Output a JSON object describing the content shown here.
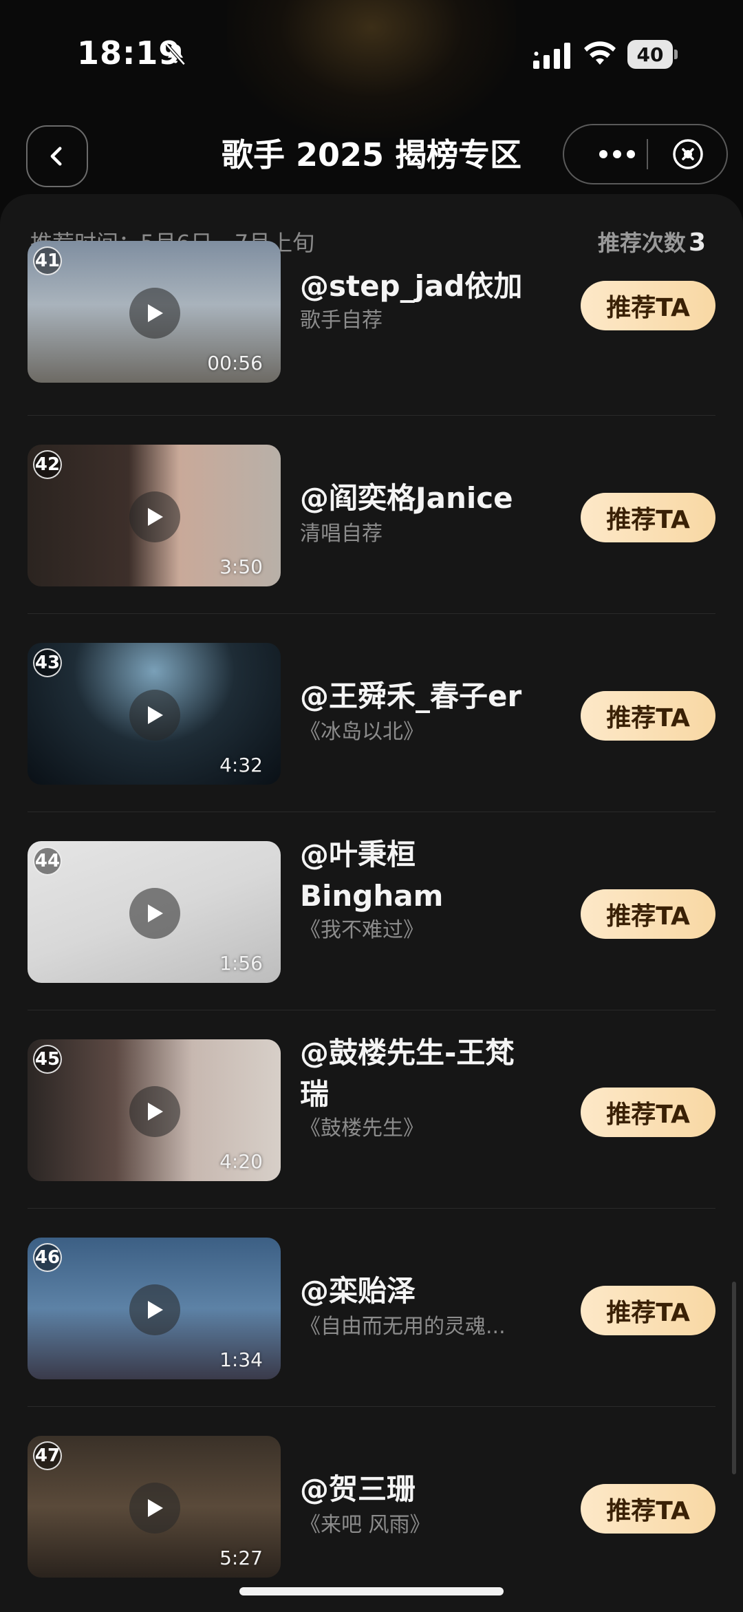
{
  "status_bar": {
    "time": "18:19",
    "battery": "40",
    "icons": [
      "bell-slash-icon",
      "cellular-signal-icon",
      "wifi-icon",
      "battery-icon"
    ]
  },
  "nav": {
    "title": "歌手 2025 揭榜专区",
    "back_icon": "chevron-left-icon",
    "more_icon": "more-dots-icon",
    "close_icon": "close-circle-icon"
  },
  "info": {
    "period": "推荐时间：5月6日—7月上旬",
    "count_label": "推荐次数",
    "count_value": "3"
  },
  "button_label": "推荐TA",
  "entries": [
    {
      "rank": "41",
      "name": "@step_jad依加",
      "subtitle": "歌手自荐",
      "duration": "00:56"
    },
    {
      "rank": "42",
      "name": "@阎奕格Janice",
      "subtitle": "清唱自荐",
      "duration": "3:50"
    },
    {
      "rank": "43",
      "name": "@王舜禾_春子er",
      "subtitle": "《冰岛以北》",
      "duration": "4:32"
    },
    {
      "rank": "44",
      "name": "@叶秉桓\nBingham",
      "subtitle": "《我不难过》",
      "duration": "1:56"
    },
    {
      "rank": "45",
      "name": "@鼓楼先生-王梵\n瑞",
      "subtitle": "《鼓楼先生》",
      "duration": "4:20"
    },
    {
      "rank": "46",
      "name": "@栾贻泽",
      "subtitle": "《自由而无用的灵魂...",
      "duration": "1:34"
    },
    {
      "rank": "47",
      "name": "@贺三珊",
      "subtitle": "《来吧 风雨》",
      "duration": "5:27"
    }
  ],
  "colors": {
    "background": "#0a0a0a",
    "panel": "#161616",
    "button_gradient_start": "#fde8c8",
    "button_gradient_end": "#f8d8a4",
    "button_text": "#3a2106"
  }
}
